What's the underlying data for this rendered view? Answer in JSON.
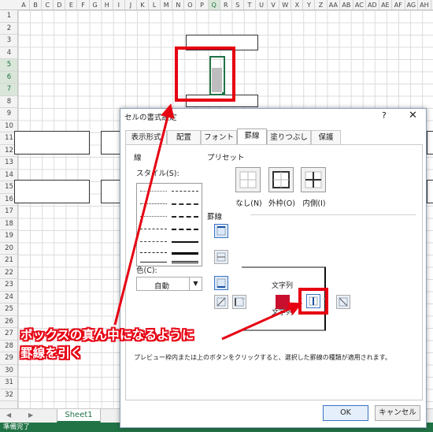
{
  "spreadsheet": {
    "columns": [
      "A",
      "B",
      "C",
      "D",
      "E",
      "F",
      "G",
      "H",
      "I",
      "J",
      "K",
      "L",
      "M",
      "N",
      "O",
      "P",
      "Q",
      "R",
      "S",
      "T",
      "U",
      "V",
      "W",
      "X",
      "Y",
      "Z",
      "AA",
      "AB",
      "AC",
      "AD",
      "AE",
      "AF",
      "AG",
      "AH"
    ],
    "rows": [
      "1",
      "2",
      "3",
      "4",
      "5",
      "6",
      "7",
      "8",
      "9",
      "10",
      "11",
      "12",
      "13",
      "14",
      "15",
      "16",
      "17",
      "18",
      "19",
      "20",
      "21",
      "22",
      "23",
      "24",
      "25",
      "26",
      "27",
      "28",
      "29",
      "30",
      "31",
      "32"
    ],
    "sheet_tab": "Sheet1",
    "status": "準備完了",
    "accent_color": "#217346"
  },
  "dialog": {
    "title": "セルの書式設定",
    "help": "?",
    "close": "✕",
    "tabs": [
      "表示形式",
      "配置",
      "フォント",
      "罫線",
      "塗りつぶし",
      "保護"
    ],
    "active_tab": "罫線",
    "line_group": "線",
    "style_label": "スタイル(S):",
    "color_label": "色(C):",
    "color_value": "自動",
    "preset_group": "プリセット",
    "presets": [
      "なし(N)",
      "外枠(O)",
      "内側(I)"
    ],
    "border_group": "罫線",
    "preview_text_1": "文字列",
    "preview_text_2": "文字列",
    "description": "プレビュー枠内または上のボタンをクリックすると、選択した罫線の種類が適用されます。",
    "ok": "OK",
    "cancel": "キャンセル"
  },
  "annotation": {
    "line1": "ボックスの真ん中になるように",
    "line2": "罫線を引く",
    "color": "#e60012"
  }
}
